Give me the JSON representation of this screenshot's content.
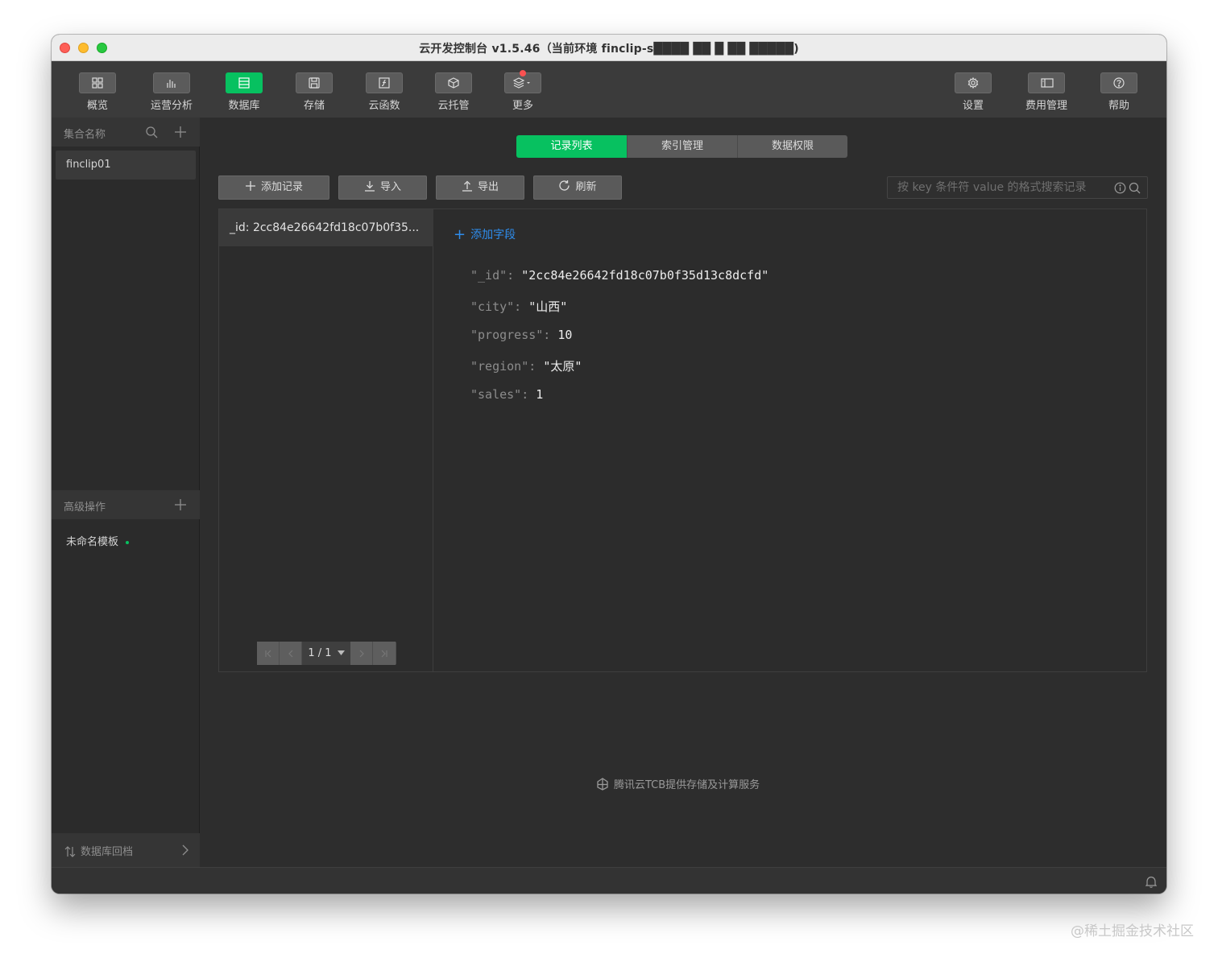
{
  "window": {
    "title": "云开发控制台 v1.5.46（当前环境 finclip-s████ ██ █ ██ █████)"
  },
  "toolbar": {
    "left": [
      {
        "label": "概览",
        "icon": "grid-icon"
      },
      {
        "label": "运营分析",
        "icon": "bar-chart-icon"
      },
      {
        "label": "数据库",
        "icon": "database-icon",
        "active": true
      },
      {
        "label": "存储",
        "icon": "storage-icon"
      },
      {
        "label": "云函数",
        "icon": "function-icon"
      },
      {
        "label": "云托管",
        "icon": "cube-icon"
      },
      {
        "label": "更多",
        "icon": "layers-icon",
        "badge": true
      }
    ],
    "right": [
      {
        "label": "设置",
        "icon": "gear-icon"
      },
      {
        "label": "费用管理",
        "icon": "billing-icon"
      },
      {
        "label": "帮助",
        "icon": "help-icon"
      }
    ]
  },
  "sidebar": {
    "collections_header": "集合名称",
    "collections": [
      "finclip01"
    ],
    "advanced_header": "高级操作",
    "templates": [
      "未命名模板"
    ],
    "footer": "数据库回档"
  },
  "tabs": [
    "记录列表",
    "索引管理",
    "数据权限"
  ],
  "actions": {
    "add": "添加记录",
    "import": "导入",
    "export": "导出",
    "refresh": "刷新"
  },
  "search": {
    "placeholder": "按 key 条件符 value 的格式搜索记录"
  },
  "records": [
    "_id: 2cc84e26642fd18c07b0f35..."
  ],
  "pager": {
    "text": "1 / 1"
  },
  "detail": {
    "add_field": "添加字段",
    "fields": [
      {
        "key": "\"_id\": ",
        "value": "\"2cc84e26642fd18c07b0f35d13c8dcfd\""
      },
      {
        "key": "\"city\": ",
        "value": "\"山西\""
      },
      {
        "key": "\"progress\": ",
        "value": "10"
      },
      {
        "key": "\"region\": ",
        "value": "\"太原\""
      },
      {
        "key": "\"sales\": ",
        "value": "1"
      }
    ]
  },
  "footer_note": "腾讯云TCB提供存储及计算服务",
  "watermark": "@稀土掘金技术社区",
  "colors": {
    "accent": "#07c160",
    "link": "#2e8ded",
    "badge": "#fa5151"
  }
}
